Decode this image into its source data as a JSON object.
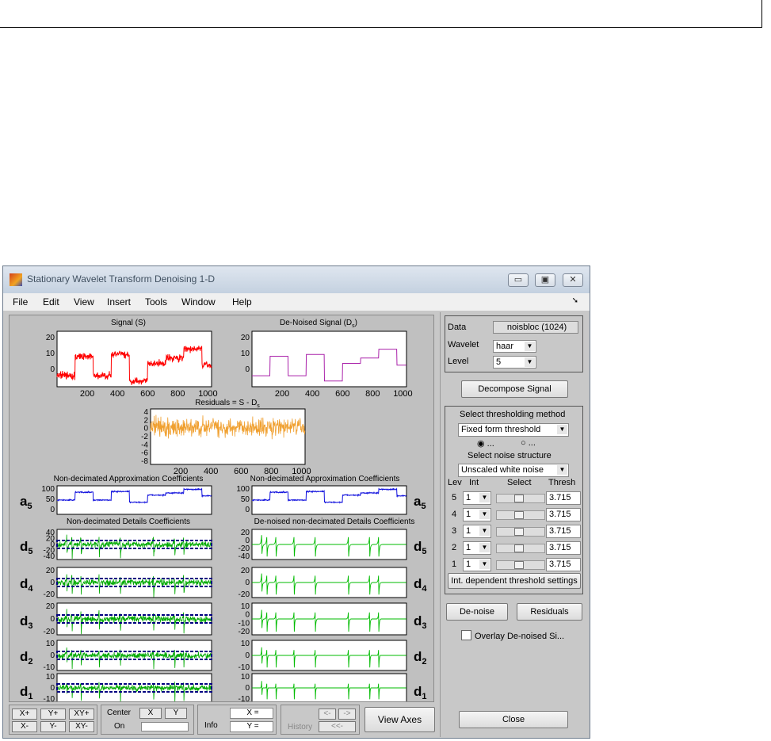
{
  "window": {
    "title": "Stationary Wavelet Transform Denoising 1-D",
    "controls": {
      "minimize": "▭",
      "maximize": "▣",
      "close": "✕"
    }
  },
  "menu": [
    "File",
    "Edit",
    "View",
    "Insert",
    "Tools",
    "Window",
    "Help"
  ],
  "plots": {
    "signal_title": "Signal (S)",
    "denoised_title": "De-Noised Signal (D",
    "denoised_sub": "s",
    "residuals_title": "Residuals = S - D",
    "residuals_sub": "s",
    "approx_left_title": "Non-decimated Approximation Coefficients",
    "approx_right_title": "Non-decimated Approximation Coefficients",
    "details_left_title": "Non-decimated Details Coefficients",
    "details_right_title": "De-noised non-decimated Details Coefficients",
    "x_ticks": [
      "200",
      "400",
      "600",
      "800",
      "1000"
    ],
    "row_labels": [
      {
        "main": "a",
        "sub": "5"
      },
      {
        "main": "d",
        "sub": "5"
      },
      {
        "main": "d",
        "sub": "4"
      },
      {
        "main": "d",
        "sub": "3"
      },
      {
        "main": "d",
        "sub": "2"
      },
      {
        "main": "d",
        "sub": "1"
      }
    ],
    "signal_yticks": [
      "20",
      "10",
      "0"
    ],
    "resid_yticks": [
      "4",
      "2",
      "0",
      "-2",
      "-4",
      "-6",
      "-8"
    ],
    "a5_yticks": [
      "100",
      "50",
      "0"
    ],
    "d5_yticks": [
      "40",
      "20",
      "0",
      "-20",
      "-40"
    ],
    "d4_yticks": [
      "20",
      "0",
      "-20"
    ],
    "d3_yticks": [
      "20",
      "0",
      "-20"
    ],
    "d2_yticks": [
      "10",
      "0",
      "-10"
    ],
    "d1_yticks": [
      "10",
      "0",
      "-10"
    ],
    "d5r_yticks": [
      "20",
      "0",
      "-20",
      "-40"
    ],
    "d4r_yticks": [
      "20",
      "0",
      "-20"
    ],
    "d3r_yticks": [
      "10",
      "0",
      "-10",
      "-20"
    ],
    "d2r_yticks": [
      "10",
      "0",
      "-10"
    ],
    "d1r_yticks": [
      "10",
      "0",
      "-10"
    ],
    "colors": {
      "signal": "#ff0000",
      "denoised": "#aa22aa",
      "residuals": "#f0a030",
      "approx": "#1010dd",
      "details_left": "#00aa00",
      "details_right": "#00bb00",
      "threshold": "#000080",
      "bg": "#ffffff"
    }
  },
  "side": {
    "data_label": "Data",
    "data_value": "noisbloc  (1024)",
    "wavelet_label": "Wavelet",
    "wavelet_value": "haar",
    "level_label": "Level",
    "level_value": "5",
    "decompose_button": "Decompose Signal",
    "thresh_method_label": "Select thresholding method",
    "thresh_method_value": "Fixed form threshold",
    "radio1": "...",
    "radio2": "...",
    "noise_label": "Select noise structure",
    "noise_value": "Unscaled white noise",
    "col_lev": "Lev",
    "col_int": "Int",
    "col_select": "Select",
    "col_thresh": "Thresh",
    "levels": [
      {
        "lev": "5",
        "int": "1",
        "thresh": "3.715"
      },
      {
        "lev": "4",
        "int": "1",
        "thresh": "3.715"
      },
      {
        "lev": "3",
        "int": "1",
        "thresh": "3.715"
      },
      {
        "lev": "2",
        "int": "1",
        "thresh": "3.715"
      },
      {
        "lev": "1",
        "int": "1",
        "thresh": "3.715"
      }
    ],
    "int_dep_button": "Int. dependent threshold settings",
    "denoise_button": "De-noise",
    "residuals_button": "Residuals",
    "overlay_label": "Overlay De-noised Si...",
    "close_button": "Close"
  },
  "bottom": {
    "xp": "X+",
    "yp": "Y+",
    "xyp": "XY+",
    "xm": "X-",
    "ym": "Y-",
    "xym": "XY-",
    "center": "Center",
    "on": "On",
    "cx": "X",
    "cy": "Y",
    "info": "Info",
    "xeq": "X =",
    "yeq": "Y =",
    "history": "History",
    "h1": "<-",
    "h2": "->",
    "h3": "<<-",
    "view_axes": "View Axes"
  }
}
